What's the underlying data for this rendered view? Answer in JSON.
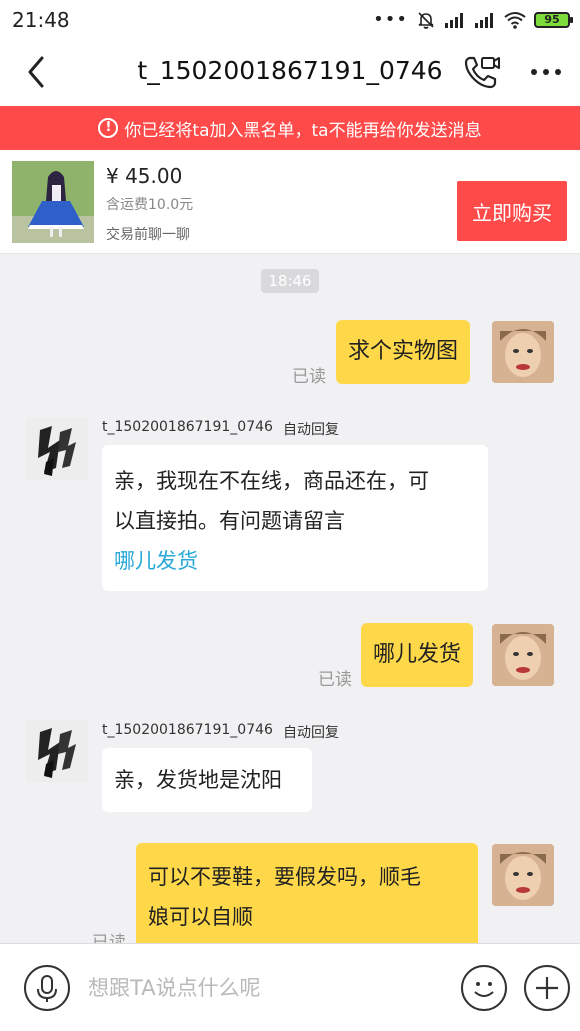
{
  "status_bar": {
    "time": "21:48",
    "dots": "•••",
    "battery": "95"
  },
  "header": {
    "title": "t_1502001867191_0746"
  },
  "warning": {
    "icon": "!",
    "text": "你已经将ta加入黑名单，ta不能再给你发送消息"
  },
  "product": {
    "price": "¥ 45.00",
    "shipping": "含运费10.0元",
    "chat_label": "交易前聊一聊",
    "buy_label": "立即购买"
  },
  "chat": {
    "timestamp": "18:46",
    "read_label": "已读",
    "auto_reply_label": "自动回复",
    "messages": [
      {
        "sender": "me",
        "text": "求个实物图",
        "read": "已读"
      },
      {
        "sender": "seller",
        "name": "t_1502001867191_0746",
        "tag": "自动回复",
        "line1": "亲，我现在不在线，商品还在，可",
        "line2": "以直接拍。有问题请留言",
        "link": "哪儿发货"
      },
      {
        "sender": "me",
        "text": "哪儿发货",
        "read": "已读"
      },
      {
        "sender": "seller",
        "name": "t_1502001867191_0746",
        "tag": "自动回复",
        "text": "亲，发货地是沈阳"
      },
      {
        "sender": "me",
        "line1": "可以不要鞋，要假发吗，顺毛",
        "line2": "娘可以自顺",
        "read": "已读"
      }
    ]
  },
  "input": {
    "placeholder": "想跟TA说点什么呢"
  },
  "icons": {
    "back": "chevron-left-icon",
    "call": "video-phone-icon",
    "more": "more-dots-icon",
    "mic": "microphone-icon",
    "emoji": "smiley-icon",
    "plus": "plus-icon"
  },
  "colors": {
    "warning": "#ff4a4a",
    "buy": "#ff4a4a",
    "my_bubble": "#ffd84a",
    "link": "#28a8d8"
  }
}
